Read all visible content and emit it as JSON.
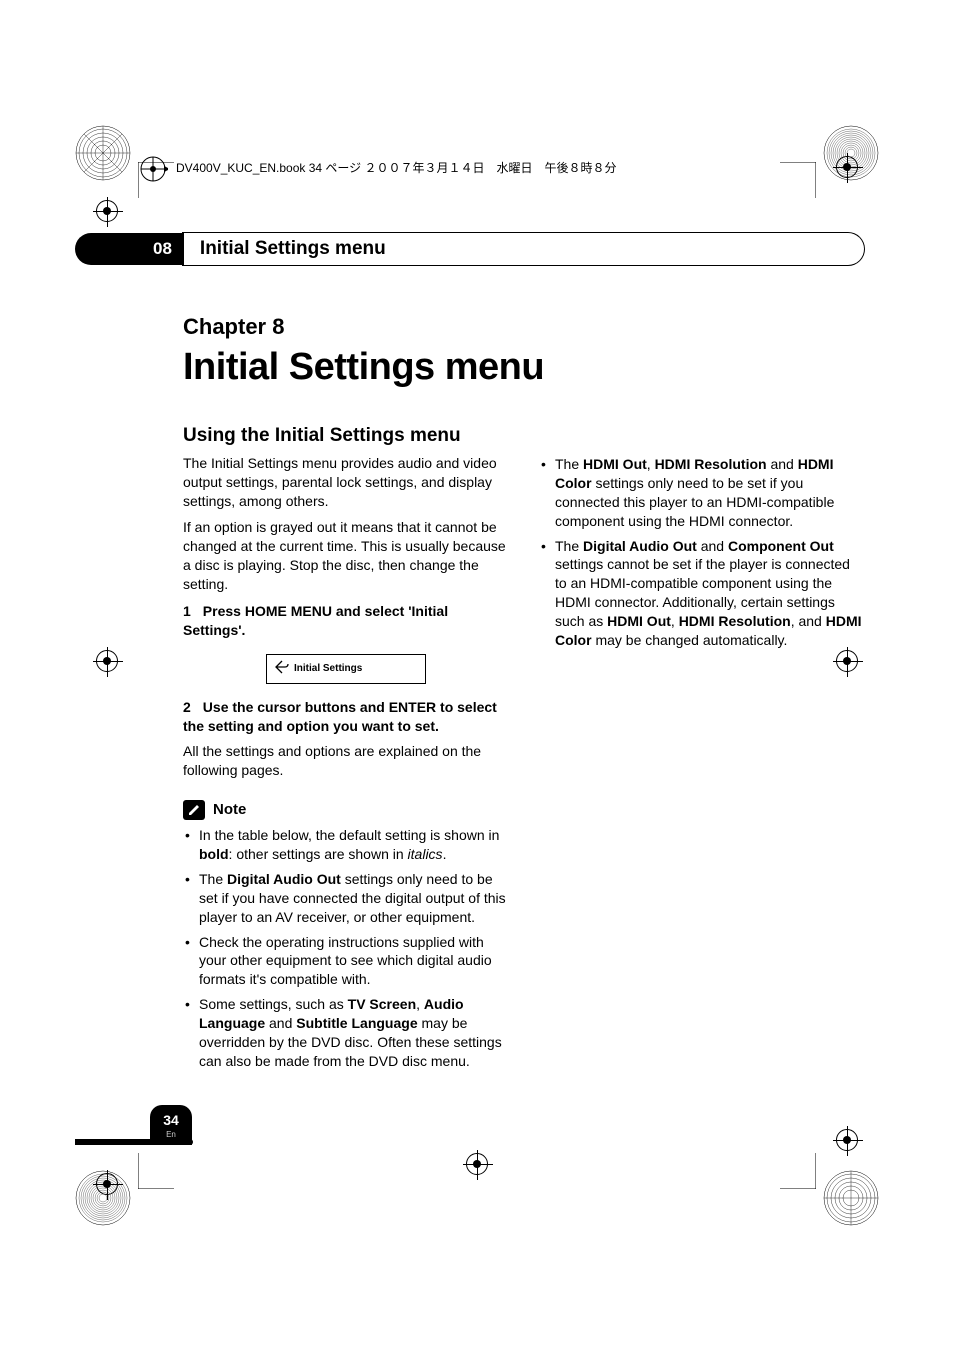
{
  "header_text": "DV400V_KUC_EN.book  34 ページ  ２００７年３月１４日　水曜日　午後８時８分",
  "chapter_badge": "08",
  "chapter_pill": "Initial Settings menu",
  "chapter_label": "Chapter 8",
  "page_heading": "Initial Settings menu",
  "section_heading": "Using the Initial Settings menu",
  "intro_para1": "The Initial Settings menu provides audio and video output settings, parental lock settings, and display settings, among others.",
  "intro_para2": "If an option is grayed out it means that it cannot be changed at the current time. This is usually because a disc is playing. Stop the disc, then change the setting.",
  "step1_num": "1",
  "step1_text": "Press HOME MENU and select 'Initial Settings'.",
  "ui_box_label": "Initial Settings",
  "step2_num": "2",
  "step2_text": "Use the cursor buttons and ENTER to select the setting and option you want to set.",
  "step2_after": "All the settings and options are explained on the following pages.",
  "note_label": "Note",
  "bullets_left": [
    {
      "pre": "In the table below, the default setting is shown in ",
      "b1": "bold",
      "mid": ": other settings are shown in ",
      "i1": "italics",
      "post": "."
    },
    {
      "pre": "The ",
      "b1": "Digital Audio Out",
      "post": " settings only need to be set if you have connected the digital output of this player to an AV receiver, or other equipment."
    },
    {
      "pre": "Check the operating instructions supplied with your other equipment to see which digital audio formats it's compatible with."
    },
    {
      "pre": "Some settings, such as ",
      "b1": "TV Screen",
      "mid": ", ",
      "b2": "Audio Language",
      "mid2": " and ",
      "b3": "Subtitle Language",
      "post": " may be overridden by the DVD disc. Often these settings can also be made from the DVD disc menu."
    }
  ],
  "bullets_right": [
    {
      "pre": "The ",
      "b1": "HDMI Out",
      "mid": ", ",
      "b2": "HDMI Resolution",
      "mid2": " and ",
      "b3": "HDMI Color",
      "post": " settings only need to be set if you connected this player to an HDMI-compatible component using the HDMI connector."
    },
    {
      "pre": "The ",
      "b1": "Digital Audio Out",
      "mid": " and ",
      "b2": "Component Out",
      "post": " settings cannot be set if the player is connected to an HDMI-compatible component using the HDMI connector. Additionally, certain settings such as ",
      "b3": "HDMI Out",
      "mid2": ", ",
      "b4": "HDMI Resolution",
      "mid3": ", and ",
      "b5": "HDMI Color",
      "post2": " may be changed automatically."
    }
  ],
  "page_number": "34",
  "page_lang": "En"
}
